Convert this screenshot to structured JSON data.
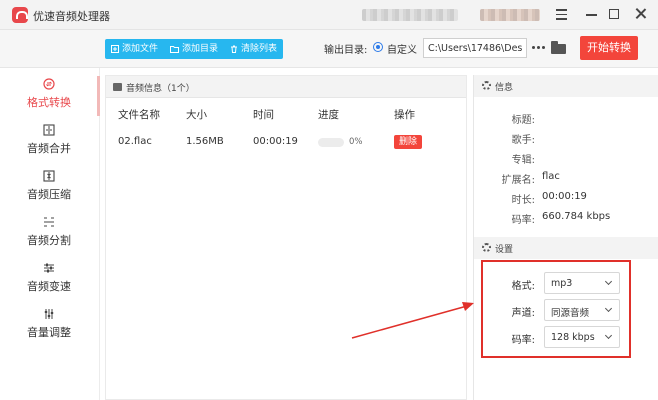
{
  "app": {
    "title": "优速音频处理器"
  },
  "toolbar": {
    "add_file": "添加文件",
    "add_dir": "添加目录",
    "clear_list": "清除列表",
    "output_label": "输出目录:",
    "custom_label": "自定义",
    "output_path": "C:\\Users\\17486\\Deskto",
    "convert_label": "开始转换"
  },
  "sidebar": {
    "items": [
      {
        "label": "格式转换",
        "icon": "format-convert-icon",
        "active": true
      },
      {
        "label": "音频合并",
        "icon": "merge-icon",
        "active": false
      },
      {
        "label": "音频压缩",
        "icon": "compress-icon",
        "active": false
      },
      {
        "label": "音频分割",
        "icon": "split-icon",
        "active": false
      },
      {
        "label": "音频变速",
        "icon": "speed-icon",
        "active": false
      },
      {
        "label": "音量调整",
        "icon": "volume-icon",
        "active": false
      }
    ]
  },
  "file_list": {
    "title": "音频信息",
    "count": "（1个）",
    "columns": [
      "文件名称",
      "大小",
      "时间",
      "进度",
      "操作"
    ],
    "rows": [
      {
        "name": "02.flac",
        "size": "1.56MB",
        "time": "00:00:19",
        "progress": 0,
        "progress_text": "0%",
        "action": "删除"
      }
    ]
  },
  "info": {
    "title": "信息",
    "fields": [
      {
        "key": "标题:",
        "value": ""
      },
      {
        "key": "歌手:",
        "value": ""
      },
      {
        "key": "专辑:",
        "value": ""
      },
      {
        "key": "扩展名:",
        "value": "flac"
      },
      {
        "key": "时长:",
        "value": "00:00:19"
      },
      {
        "key": "码率:",
        "value": "660.784 kbps"
      }
    ]
  },
  "settings": {
    "title": "设置",
    "fields": [
      {
        "key": "格式:",
        "value": "mp3"
      },
      {
        "key": "声道:",
        "value": "同源音频"
      },
      {
        "key": "码率:",
        "value": "128 kbps"
      }
    ]
  },
  "colors": {
    "accent": "#f3453b",
    "toolbar_blue": "#27b7ef",
    "highlight": "#e0302a"
  }
}
